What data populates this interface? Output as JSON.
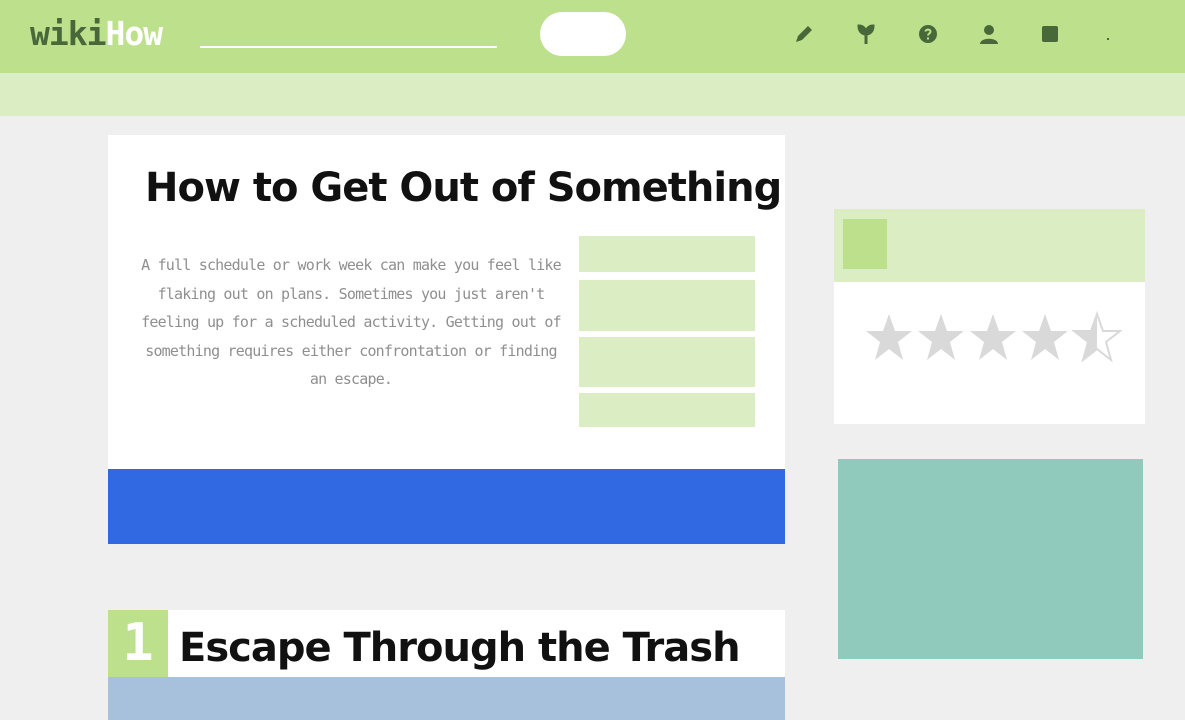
{
  "header": {
    "logo_part1": "wiki",
    "logo_part2": "How",
    "icons": [
      "edit-icon",
      "explore-icon",
      "help-icon",
      "profile-icon",
      "messages-icon"
    ],
    "colors": {
      "bar": "#bde08c",
      "logo_dark": "#49683a",
      "subbar": "#daedc3"
    }
  },
  "article": {
    "title": "How to Get Out of Something",
    "intro": "A full schedule or work week can make you feel like flaking out on plans. Sometimes you just aren't feeling up for a scheduled activity. Getting out of something requires either confrontation or finding an escape.",
    "accent_color": "#3169e3"
  },
  "step": {
    "number": "1",
    "title": "Escape Through the Trash"
  },
  "sidebar": {
    "rating": {
      "stars_filled": 4.5,
      "stars_total": 5,
      "icon": "star-icon"
    },
    "panel_color": "#8fcabd"
  }
}
